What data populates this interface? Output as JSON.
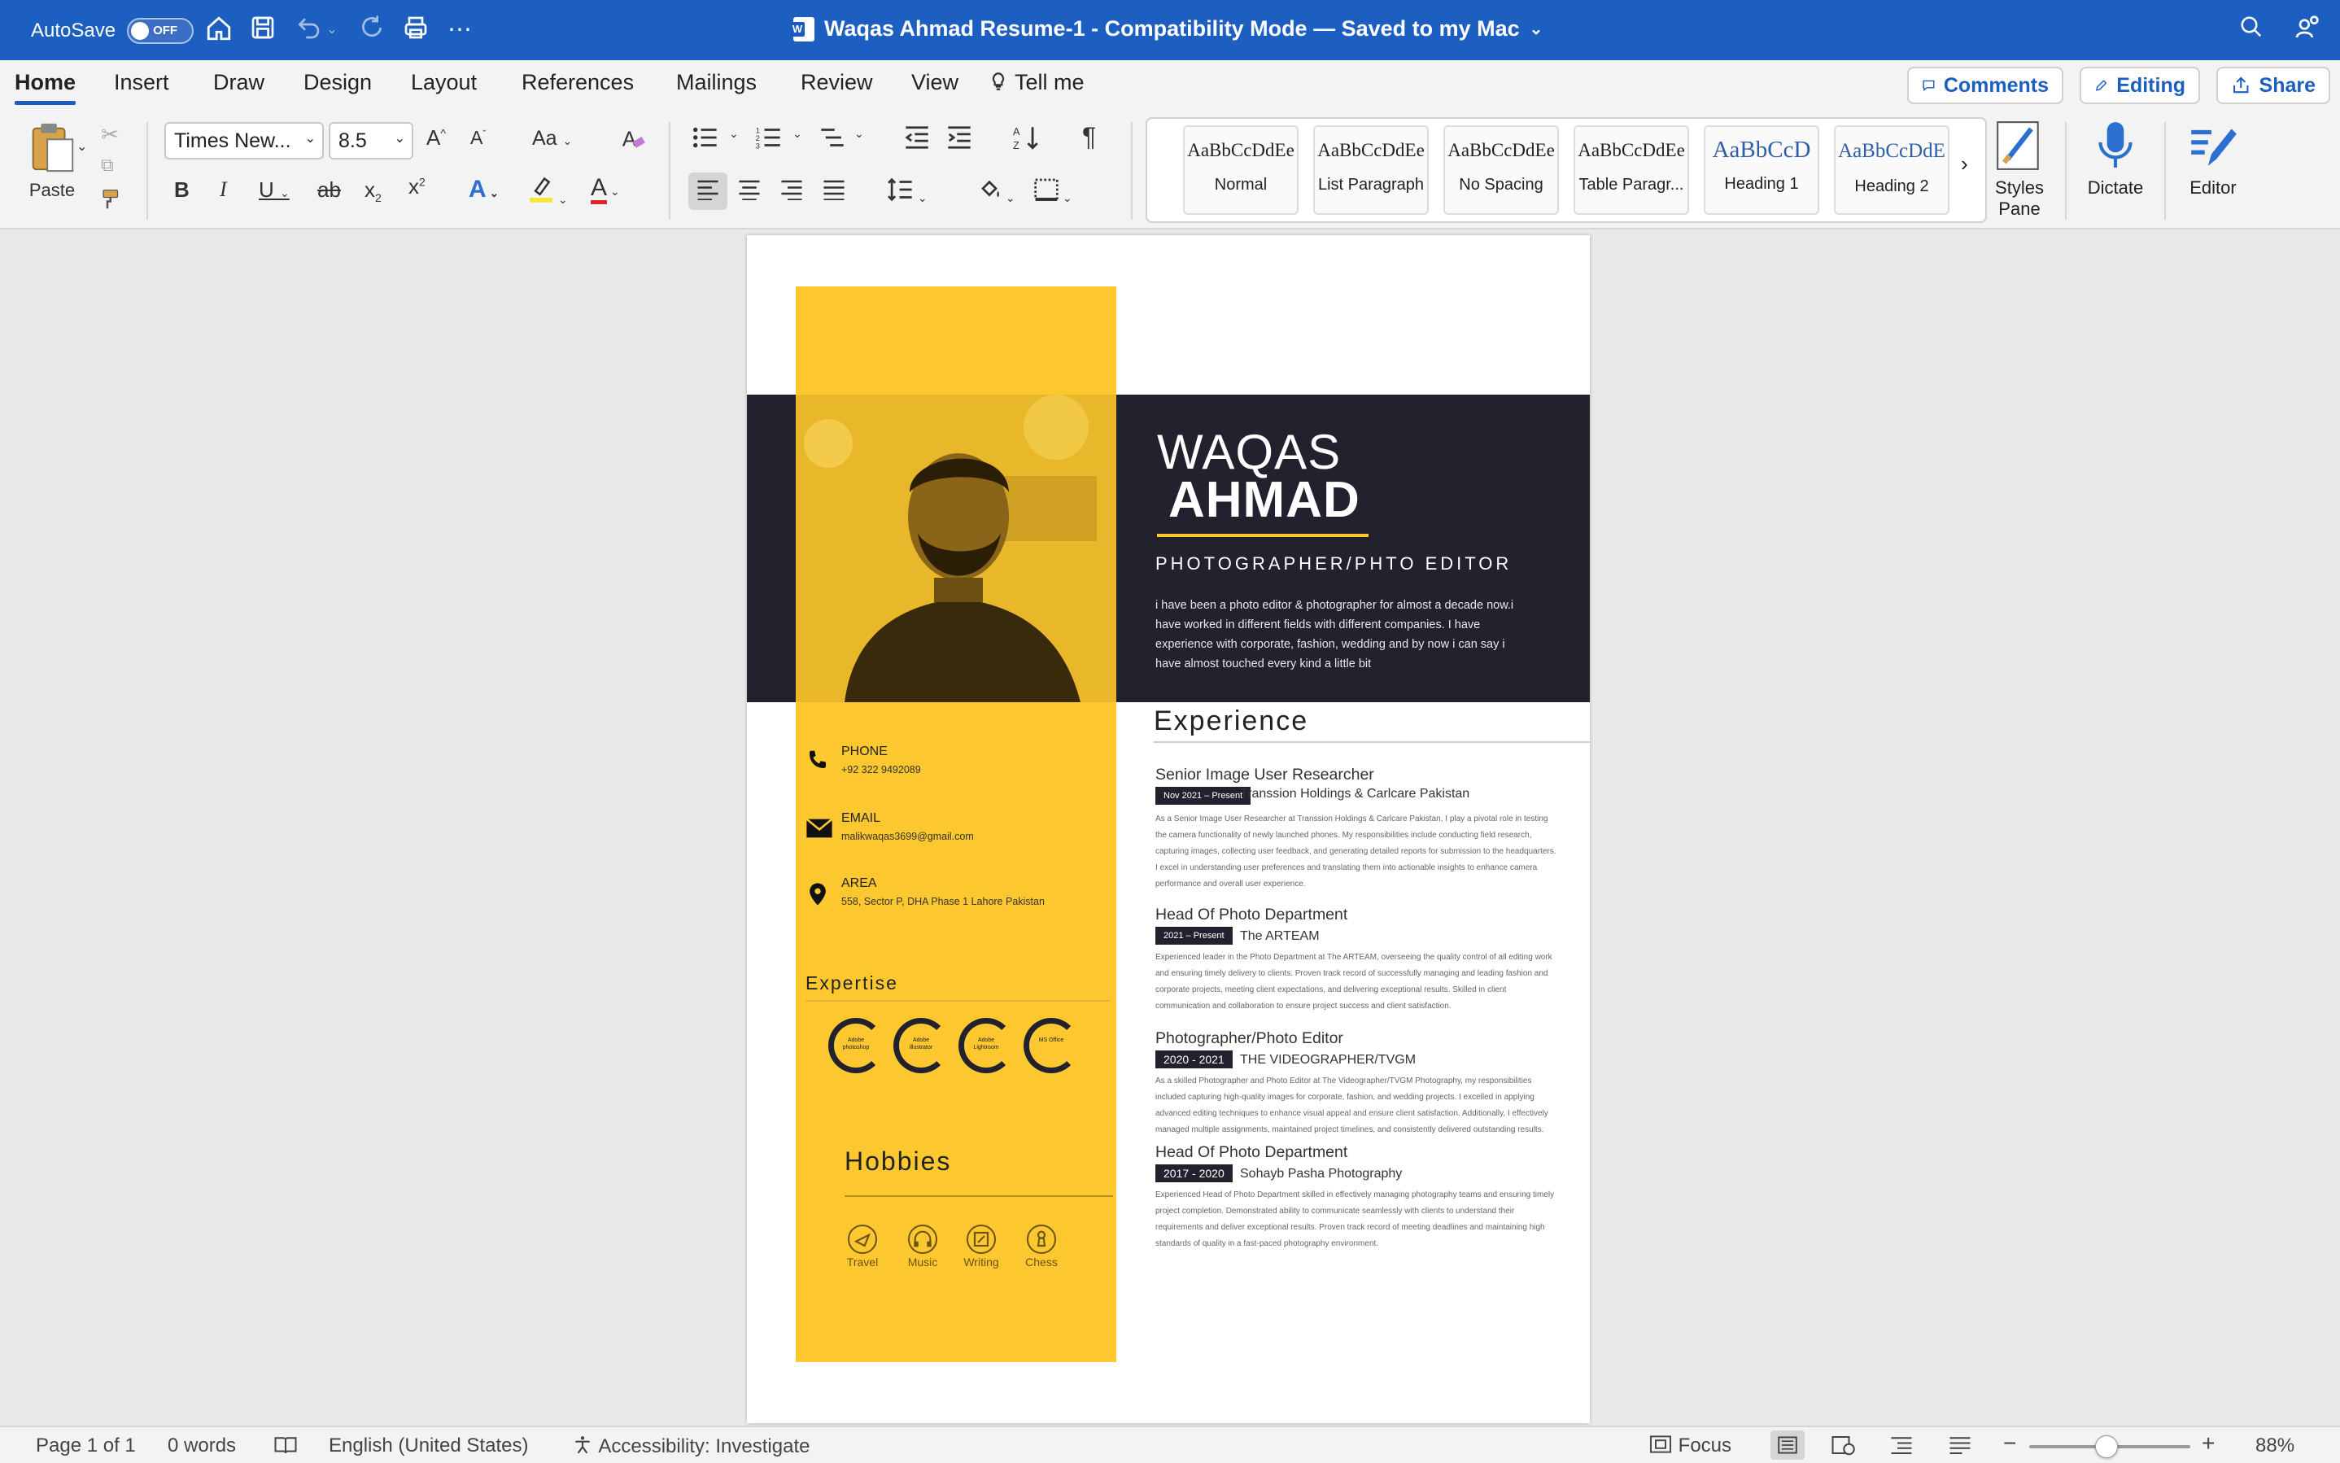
{
  "titlebar": {
    "autosave_label": "AutoSave",
    "autosave_state": "OFF",
    "document_title": "Waqas Ahmad Resume-1  -  Compatibility Mode — Saved to my Mac",
    "title_chevron": "⌄"
  },
  "tabs": [
    "Home",
    "Insert",
    "Draw",
    "Design",
    "Layout",
    "References",
    "Mailings",
    "Review",
    "View"
  ],
  "tell_me": "Tell me",
  "ribbon_buttons": {
    "comments": "Comments",
    "editing": "Editing",
    "share": "Share"
  },
  "toolbar": {
    "paste_label": "Paste",
    "font_name": "Times New...",
    "font_size": "8.5",
    "styles": [
      {
        "sample": "AaBbCcDdEe",
        "name": "Normal"
      },
      {
        "sample": "AaBbCcDdEe",
        "name": "List Paragraph"
      },
      {
        "sample": "AaBbCcDdEe",
        "name": "No Spacing"
      },
      {
        "sample": "AaBbCcDdEe",
        "name": "Table Paragr..."
      },
      {
        "sample": "AaBbCcD",
        "name": "Heading 1"
      },
      {
        "sample": "AaBbCcDdE",
        "name": "Heading 2"
      }
    ],
    "styles_pane_line1": "Styles",
    "styles_pane_line2": "Pane",
    "dictate_label": "Dictate",
    "editor_label": "Editor"
  },
  "resume": {
    "first_name": "WAQAS",
    "last_name": "AHMAD",
    "role": "PHOTOGRAPHER/PHTO EDITOR",
    "bio": "i have been a photo editor & photographer for almost a decade now.i have worked in different fields with different companies. I have experience with corporate, fashion, wedding and by now i can say i have almost touched every kind a little bit",
    "contact": {
      "phone_label": "PHONE",
      "phone_value": "+92 322 9492089",
      "email_label": "EMAIL",
      "email_value": "malikwaqas3699@gmail.com",
      "area_label": "AREA",
      "area_value": "558, Sector P, DHA Phase 1 Lahore Pakistan"
    },
    "expertise_title": "Expertise",
    "skills": [
      "Adobe photoshop",
      "Adobe illustrator",
      "Adobe Lightroom",
      "MS Office"
    ],
    "hobbies_title": "Hobbies",
    "hobbies": [
      "Travel",
      "Music",
      "Writing",
      "Chess"
    ],
    "experience_title": "Experience",
    "jobs": [
      {
        "title": "Senior Image User Researcher",
        "dates": "Nov 2021 – Present",
        "company": "Transsion Holdings & Carlcare Pakistan",
        "description": "As a Senior Image User Researcher at Transsion Holdings & Carlcare Pakistan, I play a pivotal role in testing the camera functionality of newly launched phones. My responsibilities include conducting field research, capturing images, collecting user feedback, and generating detailed reports for submission to the headquarters. I excel in understanding user preferences and translating them into actionable insights to enhance camera performance and overall user experience."
      },
      {
        "title": "Head Of Photo Department",
        "dates": "2021 – Present",
        "company": "The ARTEAM",
        "description": "Experienced leader in the Photo Department at The ARTEAM, overseeing the quality control of all editing work and ensuring timely delivery to clients. Proven track record of successfully managing and leading fashion and corporate projects, meeting client expectations, and delivering exceptional results. Skilled in client communication and collaboration to ensure project success and client satisfaction."
      },
      {
        "title": "Photographer/Photo Editor",
        "dates": "2020 - 2021",
        "company": "THE VIDEOGRAPHER/TVGM",
        "description": "As a skilled Photographer and Photo Editor at The Videographer/TVGM Photography, my responsibilities included capturing high-quality images for corporate, fashion, and wedding projects. I excelled in applying advanced editing techniques to enhance visual appeal and ensure client satisfaction. Additionally, I effectively managed multiple assignments, maintained project timelines, and consistently delivered outstanding results."
      },
      {
        "title": "Head Of Photo Department",
        "dates": "2017 - 2020",
        "company": "Sohayb Pasha Photography",
        "description": "Experienced Head of Photo Department skilled in effectively managing photography teams and ensuring timely project completion. Demonstrated ability to communicate seamlessly with clients to understand their requirements and deliver exceptional results. Proven track record of meeting deadlines and maintaining high standards of quality in a fast-paced photography environment."
      }
    ]
  },
  "statusbar": {
    "page": "Page 1 of 1",
    "words": "0 words",
    "language": "English (United States)",
    "accessibility": "Accessibility: Investigate",
    "focus": "Focus",
    "zoom": "88%",
    "zoom_level": 0.48
  },
  "colors": {
    "titlebar": "#1d5fc1",
    "resume_accent": "#fcc72f",
    "resume_dark": "#21222e"
  }
}
